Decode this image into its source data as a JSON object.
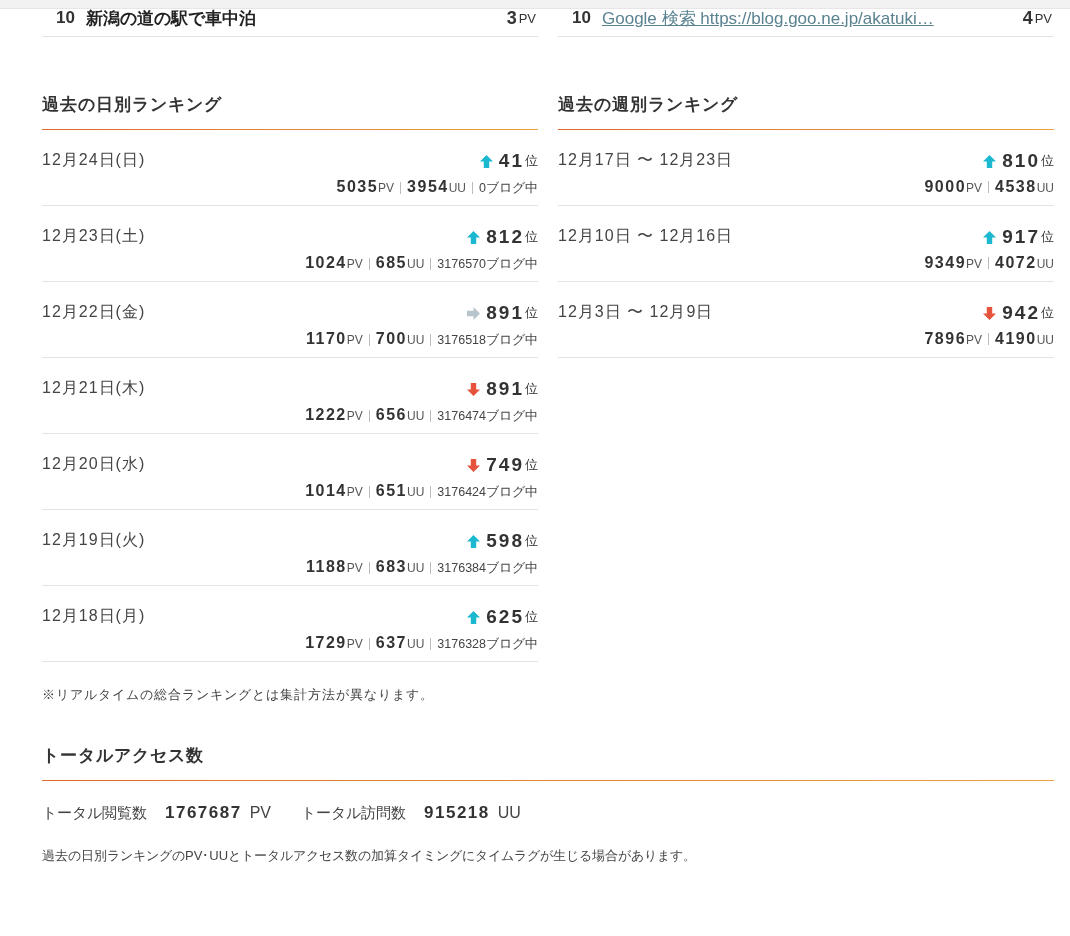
{
  "top_rows": [
    {
      "rank": "10",
      "title": "新潟の道の駅で車中泊",
      "link": false,
      "count": "3",
      "unit": "PV"
    },
    {
      "rank": "10",
      "title": "Google 検索 https://blog.goo.ne.jp/akatuki…",
      "link": true,
      "count": "4",
      "unit": "PV"
    }
  ],
  "daily": {
    "title": "過去の日別ランキング",
    "rows": [
      {
        "date": "12月24日(日)",
        "kind": "up",
        "rank": "41",
        "rank_unit": "位",
        "pv": "5035",
        "pv_unit": "PV",
        "uu": "3954",
        "uu_unit": "UU",
        "blogs": "0ブログ中"
      },
      {
        "date": "12月23日(土)",
        "kind": "up",
        "rank": "812",
        "rank_unit": "位",
        "pv": "1024",
        "pv_unit": "PV",
        "uu": "685",
        "uu_unit": "UU",
        "blogs": "3176570ブログ中"
      },
      {
        "date": "12月22日(金)",
        "kind": "same",
        "rank": "891",
        "rank_unit": "位",
        "pv": "1170",
        "pv_unit": "PV",
        "uu": "700",
        "uu_unit": "UU",
        "blogs": "3176518ブログ中"
      },
      {
        "date": "12月21日(木)",
        "kind": "down",
        "rank": "891",
        "rank_unit": "位",
        "pv": "1222",
        "pv_unit": "PV",
        "uu": "656",
        "uu_unit": "UU",
        "blogs": "3176474ブログ中"
      },
      {
        "date": "12月20日(水)",
        "kind": "down",
        "rank": "749",
        "rank_unit": "位",
        "pv": "1014",
        "pv_unit": "PV",
        "uu": "651",
        "uu_unit": "UU",
        "blogs": "3176424ブログ中"
      },
      {
        "date": "12月19日(火)",
        "kind": "up",
        "rank": "598",
        "rank_unit": "位",
        "pv": "1188",
        "pv_unit": "PV",
        "uu": "683",
        "uu_unit": "UU",
        "blogs": "3176384ブログ中"
      },
      {
        "date": "12月18日(月)",
        "kind": "up",
        "rank": "625",
        "rank_unit": "位",
        "pv": "1729",
        "pv_unit": "PV",
        "uu": "637",
        "uu_unit": "UU",
        "blogs": "3176328ブログ中"
      }
    ],
    "note": "※リアルタイムの総合ランキングとは集計方法が異なります。"
  },
  "weekly": {
    "title": "過去の週別ランキング",
    "rows": [
      {
        "date": "12月17日 〜 12月23日",
        "kind": "up",
        "rank": "810",
        "rank_unit": "位",
        "pv": "9000",
        "pv_unit": "PV",
        "uu": "4538",
        "uu_unit": "UU"
      },
      {
        "date": "12月10日 〜 12月16日",
        "kind": "up",
        "rank": "917",
        "rank_unit": "位",
        "pv": "9349",
        "pv_unit": "PV",
        "uu": "4072",
        "uu_unit": "UU"
      },
      {
        "date": "12月3日 〜 12月9日",
        "kind": "down",
        "rank": "942",
        "rank_unit": "位",
        "pv": "7896",
        "pv_unit": "PV",
        "uu": "4190",
        "uu_unit": "UU"
      }
    ]
  },
  "total": {
    "title": "トータルアクセス数",
    "items": [
      {
        "label": "トータル閲覧数",
        "value": "1767687",
        "unit": "PV"
      },
      {
        "label": "トータル訪問数",
        "value": "915218",
        "unit": "UU"
      }
    ],
    "note": "過去の日別ランキングのPV･UUとトータルアクセス数の加算タイミングにタイムラグが生じる場合があります。"
  }
}
